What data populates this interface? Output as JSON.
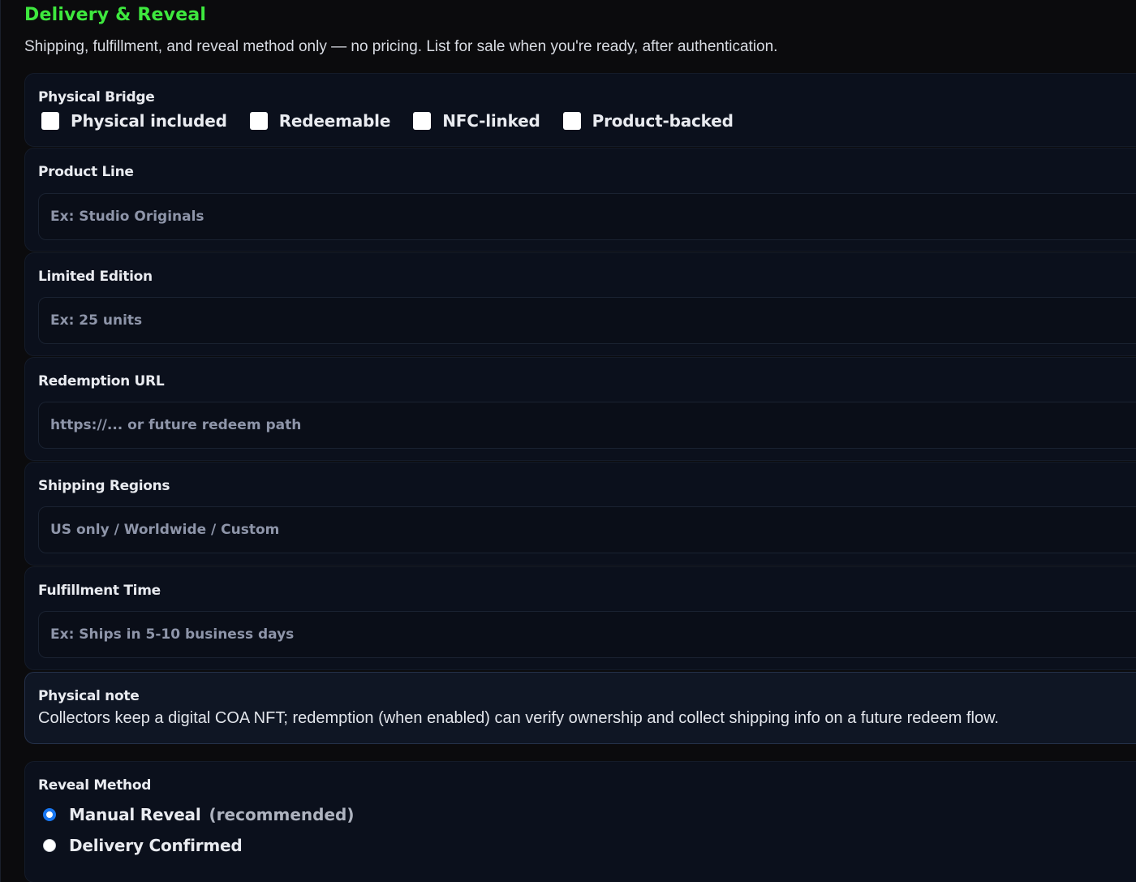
{
  "header": {
    "title": "Delivery & Reveal",
    "subtitle": "Shipping, fulfillment, and reveal method only — no pricing. List for sale when you're ready, after authentication."
  },
  "physical_bridge": {
    "label": "Physical Bridge",
    "options": [
      {
        "label": "Physical included",
        "checked": false
      },
      {
        "label": "Redeemable",
        "checked": false
      },
      {
        "label": "NFC-linked",
        "checked": false
      },
      {
        "label": "Product-backed",
        "checked": false
      }
    ]
  },
  "fields": {
    "product_line": {
      "label": "Product Line",
      "value": "",
      "placeholder": "Ex: Studio Originals"
    },
    "limited_edition": {
      "label": "Limited Edition",
      "value": "",
      "placeholder": "Ex: 25 units"
    },
    "redemption_url": {
      "label": "Redemption URL",
      "value": "",
      "placeholder": "https://... or future redeem path"
    },
    "shipping_regions": {
      "label": "Shipping Regions",
      "value": "",
      "placeholder": "US only / Worldwide / Custom"
    },
    "fulfillment_time": {
      "label": "Fulfillment Time",
      "value": "",
      "placeholder": "Ex: Ships in 5-10 business days"
    }
  },
  "physical_note": {
    "label": "Physical note",
    "text": "Collectors keep a digital COA NFT; redemption (when enabled) can verify ownership and collect shipping info on a future redeem flow."
  },
  "reveal_method": {
    "label": "Reveal Method",
    "options": [
      {
        "label": "Manual Reveal",
        "hint": "(recommended)",
        "selected": true
      },
      {
        "label": "Delivery Confirmed",
        "hint": "",
        "selected": false
      }
    ]
  },
  "colors": {
    "accent_title": "#3ee83e",
    "radio_selected": "#1877f2",
    "background": "#0b0b0d",
    "card_background": "#0b101c"
  }
}
